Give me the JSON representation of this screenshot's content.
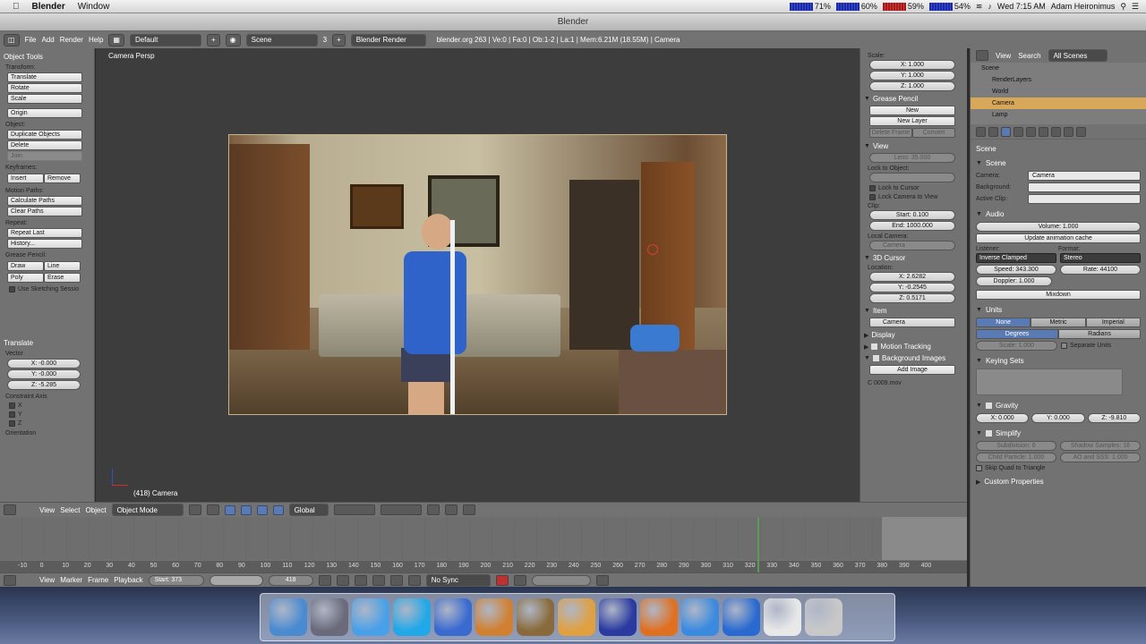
{
  "mac_menu": {
    "app": "Blender",
    "window": "Window",
    "meters": [
      "71%",
      "60%",
      "59%",
      "54%"
    ],
    "clock": "Wed 7:15 AM",
    "user": "Adam Heironimus"
  },
  "window_title": "Blender",
  "info_header": {
    "menus": [
      "File",
      "Add",
      "Render",
      "Help"
    ],
    "layout": "Default",
    "scene": "Scene",
    "scene_count": "3",
    "engine": "Blender Render",
    "stats": "blender.org 263 | Ve:0 | Fa:0 | Ob:1-2 | La:1 | Mem:6.21M (18.55M) | Camera"
  },
  "tool_shelf": {
    "title": "Object Tools",
    "transform_label": "Transform:",
    "translate": "Translate",
    "rotate": "Rotate",
    "scale": "Scale",
    "origin": "Origin",
    "object_label": "Object:",
    "duplicate": "Duplicate Objects",
    "delete": "Delete",
    "join": "Join",
    "keyframes_label": "Keyframes:",
    "insert": "Insert",
    "remove": "Remove",
    "motion_label": "Motion Paths:",
    "calc_paths": "Calculate Paths",
    "clear_paths": "Clear Paths",
    "repeat_label": "Repeat:",
    "repeat_last": "Repeat Last",
    "history": "History...",
    "grease_label": "Grease Pencil:",
    "draw": "Draw",
    "line": "Line",
    "poly": "Poly",
    "erase": "Erase",
    "sketch": "Use Sketching Sessio",
    "op_title": "Translate",
    "vector_label": "Vector",
    "vx": "X: -0.000",
    "vy": "Y: -0.000",
    "vz": "Z: -5.285",
    "constraint_label": "Constraint Axis",
    "cx": "X",
    "cy": "Y",
    "cz": "Z",
    "orientation_label": "Orientation"
  },
  "viewport": {
    "label": "Camera Persp",
    "object_label": "(418) Camera"
  },
  "vp_header": {
    "view": "View",
    "select": "Select",
    "object": "Object",
    "mode": "Object Mode",
    "orientation": "Global"
  },
  "npanel": {
    "scale_label": "Scale:",
    "sx": "X: 1.000",
    "sy": "Y: 1.000",
    "sz": "Z: 1.000",
    "grease_title": "Grease Pencil",
    "new": "New",
    "new_layer": "New Layer",
    "delete_frame": "Delete Frame",
    "convert": "Convert",
    "view_title": "View",
    "lens": "Lens: 35.000",
    "lock_to_object": "Lock to Object:",
    "lock_to_cursor": "Lock to Cursor",
    "lock_cam": "Lock Camera to View",
    "clip_label": "Clip:",
    "clip_start": "Start: 0.100",
    "clip_end": "End: 1000.000",
    "local_cam_label": "Local Camera:",
    "local_cam": "Camera",
    "cursor_title": "3D Cursor",
    "location_label": "Location:",
    "cx": "X: 2.6282",
    "cy": "Y: -0.2545",
    "cz": "Z: 0.5171",
    "item_title": "Item",
    "item_name": "Camera",
    "display_title": "Display",
    "motion_tracking": "Motion Tracking",
    "bg_images": "Background Images",
    "add_image": "Add Image",
    "image_name": "C 0009.mov"
  },
  "outliner": {
    "view": "View",
    "search": "Search",
    "filter": "All Scenes",
    "rows": [
      "Scene",
      "RenderLayers",
      "World",
      "Camera",
      "Lamp"
    ]
  },
  "props": {
    "scene_crumb": "Scene",
    "scene_title": "Scene",
    "camera_label": "Camera:",
    "camera_value": "Camera",
    "background_label": "Background:",
    "active_clip_label": "Active Clip:",
    "audio_title": "Audio",
    "volume": "Volume: 1.000",
    "update_cache": "Update animation cache",
    "listener_label": "Listener:",
    "format_label": "Format:",
    "listener": "Inverse Clamped",
    "format": "Stereo",
    "speed": "Speed: 343.300",
    "rate": "Rate: 44100",
    "doppler": "Doppler: 1.000",
    "mixdown": "Mixdown",
    "units_title": "Units",
    "unit_none": "None",
    "unit_metric": "Metric",
    "unit_imperial": "Imperial",
    "degrees": "Degrees",
    "radians": "Radians",
    "unit_scale": "Scale: 1.000",
    "separate_units": "Separate Units",
    "keying_title": "Keying Sets",
    "gravity_title": "Gravity",
    "gx": "X: 0.000",
    "gy": "Y: 0.000",
    "gz": "Z: -9.810",
    "simplify_title": "Simplify",
    "subdivision": "Subdivision: 6",
    "shadow_samples": "Shadow Samples: 16",
    "child_particle": "Child Particle: 1.000",
    "ao_sss": "AO and SSS: 1.000",
    "skip_quad": "Skip Quad to Triangle",
    "custom_props": "Custom Properties"
  },
  "timeline": {
    "ticks": [
      "-10",
      "0",
      "10",
      "20",
      "30",
      "40",
      "50",
      "60",
      "70",
      "80",
      "90",
      "100",
      "110",
      "120",
      "130",
      "140",
      "150",
      "160",
      "170",
      "180",
      "190",
      "200",
      "210",
      "220",
      "230",
      "240",
      "250",
      "260",
      "270",
      "280",
      "290",
      "300",
      "310",
      "320",
      "330",
      "340",
      "350",
      "360",
      "370",
      "380",
      "390",
      "400"
    ],
    "current_frame": 418
  },
  "tl_header": {
    "view": "View",
    "marker": "Marker",
    "frame": "Frame",
    "playback": "Playback",
    "start": "Start: 373",
    "current": "418",
    "sync": "No Sync"
  },
  "dock": {
    "icons": [
      "finder-icon",
      "launchpad-icon",
      "messages-icon",
      "skype-icon",
      "itunes-icon",
      "garageband-icon",
      "imovie-icon",
      "sketch-icon",
      "audacity-icon",
      "blender-icon",
      "safari-icon",
      "quicktime-icon",
      "document-icon",
      "trash-icon"
    ],
    "colors": [
      "#4a8ad0",
      "#6a6a7a",
      "#4aa0e8",
      "#20a8e8",
      "#3a6ad0",
      "#d08030",
      "#8a6a3a",
      "#e0a040",
      "#2a3aa0",
      "#e07020",
      "#3a8ae0",
      "#2a6ad0",
      "#e8e8e8",
      "#c8c8c8"
    ]
  }
}
